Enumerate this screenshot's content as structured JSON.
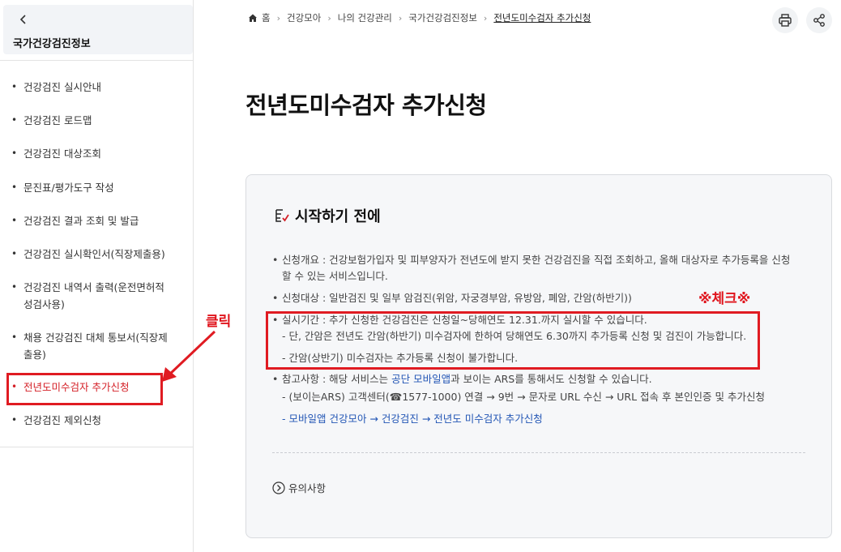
{
  "sidebar": {
    "title": "국가건강검진정보",
    "items": [
      {
        "label": "건강검진 실시안내"
      },
      {
        "label": "건강검진 로드맵"
      },
      {
        "label": "건강검진 대상조회"
      },
      {
        "label": "문진표/평가도구 작성"
      },
      {
        "label": "건강검진 결과 조회 및 발급"
      },
      {
        "label": "건강검진 실시확인서(직장제출용)"
      },
      {
        "label": "건강검진 내역서 출력(운전면허적성검사용)"
      },
      {
        "label": "채용 건강검진 대체 통보서(직장제출용)"
      },
      {
        "label": "전년도미수검자 추가신청",
        "active": true
      },
      {
        "label": "건강검진 제외신청"
      }
    ]
  },
  "breadcrumb": {
    "home": "홈",
    "items": [
      "건강모아",
      "나의 건강관리",
      "국가건강검진정보",
      "전년도미수검자 추가신청"
    ]
  },
  "header": {
    "print_icon": "print-icon",
    "share_icon": "share-icon"
  },
  "page": {
    "title": "전년도미수검자 추가신청"
  },
  "panel": {
    "heading": "시작하기 전에",
    "overview_line1": "신청개요 : 건강보험가입자 및 피부양자가 전년도에 받지 못한 건강검진을 직접 조회하고, 올해 대상자로 추가등록을 신청",
    "overview_line2": "할 수 있는 서비스입니다.",
    "target": "신청대상 : 일반검진 및 일부 암검진(위암, 자궁경부암, 유방암, 폐암, 간암(하반기))",
    "period": "실시기간 : 추가 신청한 건강검진은 신청일~당해연도 12.31.까지 실시할 수 있습니다.",
    "period_sub1": "- 단, 간암은 전년도 간암(하반기) 미수검자에 한하여 당해연도 6.30까지 추가등록 신청 및 검진이 가능합니다.",
    "period_sub2": "- 간암(상반기) 미수검자는 추가등록 신청이 불가합니다.",
    "ref_prefix": "참고사항 : 해당 서비스는 ",
    "ref_link1": "공단",
    "ref_space": " ",
    "ref_link2": "모바일앱",
    "ref_suffix": "과 보이는 ARS를 통해서도 신청할 수 있습니다.",
    "ref_sub1": "- (보이는ARS) 고객센터(☎1577-1000) 연결 → 9번 → 문자로 URL 수신 → URL 접속 후 본인인증 및 추가신청",
    "ref_sub2": "- 모바일앱 건강모아 → 건강검진 → 전년도 미수검자 추가신청",
    "notice": "유의사항"
  },
  "annotations": {
    "click": "클릭",
    "check": "※체크※",
    "color": "#e01b22"
  }
}
